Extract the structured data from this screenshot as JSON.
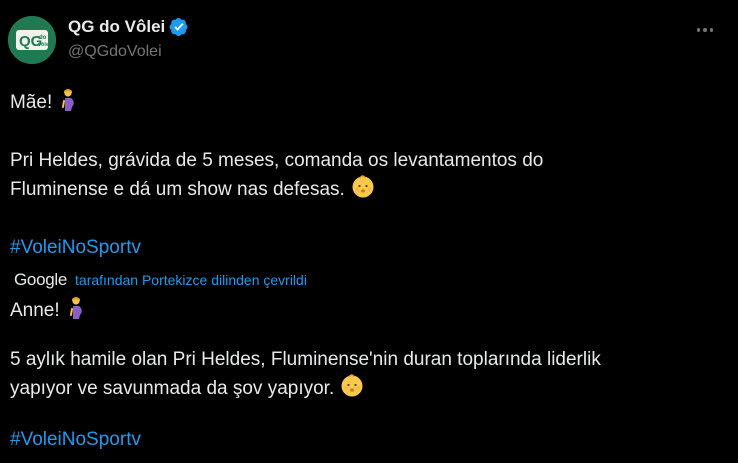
{
  "author": {
    "display_name": "QG do Vôlei",
    "handle": "@QGdoVolei",
    "avatar_text": "QG do vôlei",
    "verified": true
  },
  "original": {
    "line1": "Mãe!",
    "line2a": "Pri Heldes, grávida de 5 meses, comanda os levantamentos do",
    "line2b": "Fluminense e dá um show nas defesas.",
    "hashtag": "#VoleiNoSportv"
  },
  "translation": {
    "provider": "Google",
    "note": "tarafından Portekizce dilinden çevrildi",
    "line1": "Anne!",
    "line2a": "5 aylık hamile olan Pri Heldes, Fluminense'nin duran toplarında liderlik",
    "line2b": "yapıyor ve savunmada da şov yapıyor.",
    "hashtag": "#VoleiNoSportv"
  },
  "icons": {
    "verified": "verified-badge-icon",
    "more": "more-options-icon",
    "pregnant": "pregnant-woman-emoji",
    "baby": "baby-emoji"
  },
  "colors": {
    "background": "#000000",
    "text": "#e7e9ea",
    "muted": "#71767b",
    "link": "#1d9bf0",
    "avatar": "#1f7a52"
  }
}
